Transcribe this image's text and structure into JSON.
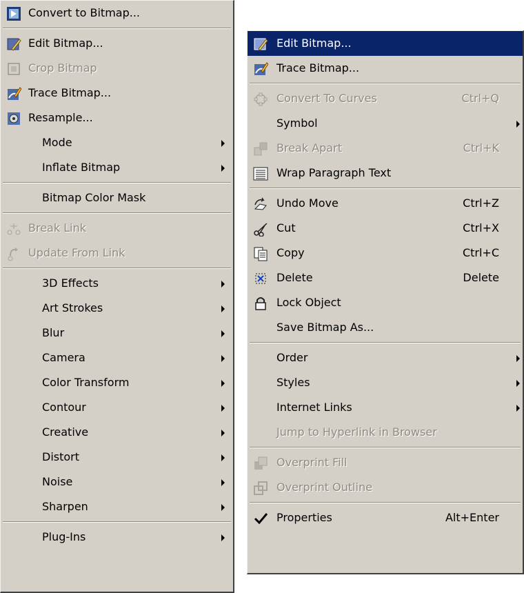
{
  "menu1": {
    "items": [
      {
        "label": "Convert to Bitmap...",
        "icon": "convert-bitmap-icon"
      },
      {
        "label": "Edit Bitmap...",
        "icon": "edit-bitmap-icon"
      },
      {
        "label": "Crop Bitmap",
        "icon": "crop-bitmap-icon",
        "disabled": true
      },
      {
        "label": "Trace Bitmap...",
        "icon": "trace-bitmap-icon"
      },
      {
        "label": "Resample...",
        "icon": "resample-icon"
      },
      {
        "label": "Mode",
        "submenu": true
      },
      {
        "label": "Inflate Bitmap",
        "submenu": true
      },
      {
        "label": "Bitmap Color Mask"
      },
      {
        "label": "Break Link",
        "icon": "break-link-icon",
        "disabled": true
      },
      {
        "label": "Update From Link",
        "icon": "update-link-icon",
        "disabled": true
      },
      {
        "label": "3D Effects",
        "submenu": true
      },
      {
        "label": "Art Strokes",
        "submenu": true
      },
      {
        "label": "Blur",
        "submenu": true
      },
      {
        "label": "Camera",
        "submenu": true
      },
      {
        "label": "Color Transform",
        "submenu": true
      },
      {
        "label": "Contour",
        "submenu": true
      },
      {
        "label": "Creative",
        "submenu": true
      },
      {
        "label": "Distort",
        "submenu": true
      },
      {
        "label": "Noise",
        "submenu": true
      },
      {
        "label": "Sharpen",
        "submenu": true
      },
      {
        "label": "Plug-Ins",
        "submenu": true
      }
    ]
  },
  "menu2": {
    "items": [
      {
        "label": "Edit Bitmap...",
        "icon": "edit-bitmap-icon",
        "highlighted": true
      },
      {
        "label": "Trace Bitmap...",
        "icon": "trace-bitmap-icon"
      },
      {
        "label": "Convert To Curves",
        "shortcut": "Ctrl+Q",
        "icon": "convert-curves-icon",
        "disabled": true
      },
      {
        "label": "Symbol",
        "submenu": true
      },
      {
        "label": "Break Apart",
        "shortcut": "Ctrl+K",
        "icon": "break-apart-icon",
        "disabled": true
      },
      {
        "label": "Wrap Paragraph Text",
        "icon": "wrap-text-icon"
      },
      {
        "label": "Undo Move",
        "shortcut": "Ctrl+Z",
        "icon": "undo-icon"
      },
      {
        "label": "Cut",
        "shortcut": "Ctrl+X",
        "icon": "scissors-icon"
      },
      {
        "label": "Copy",
        "shortcut": "Ctrl+C",
        "icon": "copy-icon"
      },
      {
        "label": "Delete",
        "shortcut": "Delete",
        "icon": "delete-icon"
      },
      {
        "label": "Lock Object",
        "icon": "lock-icon"
      },
      {
        "label": "Save Bitmap As..."
      },
      {
        "label": "Order",
        "submenu": true
      },
      {
        "label": "Styles",
        "submenu": true
      },
      {
        "label": "Internet Links",
        "submenu": true
      },
      {
        "label": "Jump to Hyperlink in Browser",
        "disabled": true
      },
      {
        "label": "Overprint Fill",
        "icon": "overprint-fill-icon",
        "disabled": true
      },
      {
        "label": "Overprint Outline",
        "icon": "overprint-outline-icon",
        "disabled": true
      },
      {
        "label": "Properties",
        "shortcut": "Alt+Enter",
        "icon": "checkmark-icon"
      }
    ]
  },
  "colors": {
    "menu_bg": "#d4d0c8",
    "highlight": "#0a246a",
    "disabled_text": "#8f8b82"
  }
}
